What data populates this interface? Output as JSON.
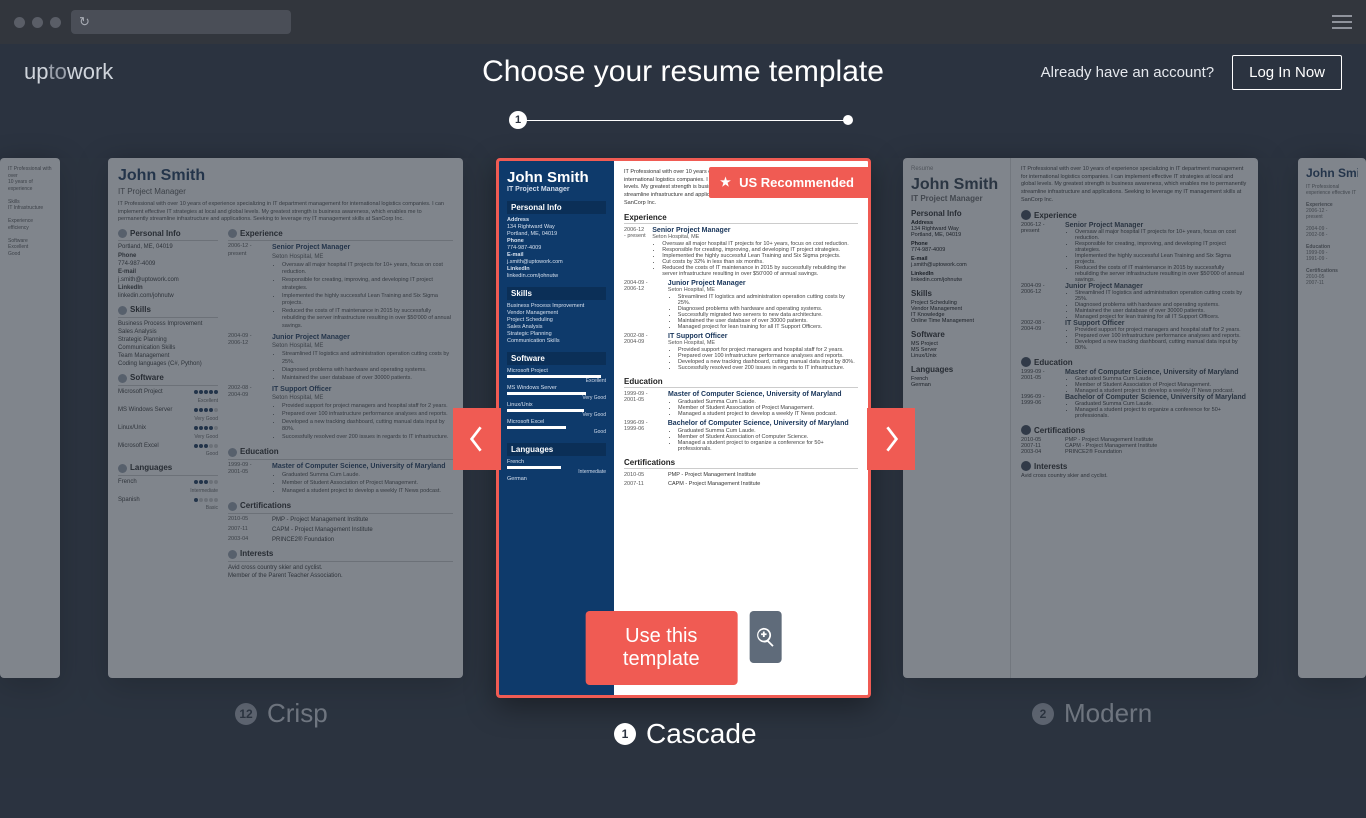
{
  "header": {
    "logo_a": "up",
    "logo_b": "to",
    "logo_c": "work",
    "title": "Choose your resume template",
    "account_q": "Already have an account?",
    "login": "Log In Now"
  },
  "progress": {
    "step": "1"
  },
  "nav": {
    "prev": "‹",
    "next": "›"
  },
  "badge": "US Recommended",
  "cta": {
    "use": "Use this template"
  },
  "labels": {
    "crisp": {
      "n": "12",
      "t": "Crisp"
    },
    "cascade": {
      "n": "1",
      "t": "Cascade"
    },
    "modern": {
      "n": "2",
      "t": "Modern"
    }
  },
  "resume": {
    "name": "John Smith",
    "role": "IT Project Manager",
    "summary": "IT Professional with over 10 years of experience specializing in IT department management for international logistics companies. I can implement effective IT strategies at local and global levels. My greatest strength is business awareness, which enables me to permanently streamline infrastructure and applications. Seeking to leverage my IT management skills at SanCorp Inc.",
    "personal": {
      "h": "Personal Info",
      "addr_h": "Address",
      "addr1": "134 Rightward Way",
      "addr2": "Portland, ME, 04019",
      "phone_h": "Phone",
      "phone": "774-987-4009",
      "email_h": "E-mail",
      "email": "j.smith@uptowork.com",
      "li_h": "LinkedIn",
      "li": "linkedin.com/johnutw"
    },
    "skills": {
      "h": "Skills",
      "items": [
        "Business Process Improvement",
        "Vendor Management",
        "Project Scheduling",
        "Sales Analysis",
        "Strategic Planning",
        "Communication Skills"
      ]
    },
    "skills_ext": [
      "Team Management",
      "Coding languages (C#, Python)"
    ],
    "software": {
      "h": "Software",
      "items": [
        {
          "n": "Microsoft Project",
          "r": "Excellent"
        },
        {
          "n": "MS Windows Server",
          "r": "Very Good"
        },
        {
          "n": "Linux/Unix",
          "r": "Very Good"
        },
        {
          "n": "Microsoft Excel",
          "r": "Good"
        }
      ]
    },
    "languages": {
      "h": "Languages",
      "items": [
        {
          "n": "French",
          "r": "Intermediate"
        },
        {
          "n": "German",
          "r": ""
        },
        {
          "n": "Spanish",
          "r": "Basic"
        }
      ]
    },
    "exp": {
      "h": "Experience",
      "jobs": [
        {
          "d": "2006-12 - present",
          "t": "Senior Project Manager",
          "c": "Seton Hospital, ME",
          "b": [
            "Oversaw all major hospital IT projects for 10+ years, focus on cost reduction.",
            "Responsible for creating, improving, and developing IT project strategies.",
            "Implemented the highly successful Lean Training and Six Sigma projects.",
            "Cut costs by 32% in less than six months.",
            "Reduced the costs of IT maintenance in 2015 by successfully rebuilding the server infrastructure resulting in over $50'000 of annual savings."
          ]
        },
        {
          "d": "2004-09 - 2006-12",
          "t": "Junior Project Manager",
          "c": "Seton Hospital, ME",
          "b": [
            "Streamlined IT logistics and administration operation cutting costs by 25%.",
            "Diagnosed problems with hardware and operating systems.",
            "Successfully migrated two servers to new data architecture.",
            "Maintained the user database of over 30000 patients.",
            "Managed project for lean training for all IT Support Officers."
          ]
        },
        {
          "d": "2002-08 - 2004-09",
          "t": "IT Support Officer",
          "c": "Seton Hospital, ME",
          "b": [
            "Provided support for project managers and hospital staff for 2 years.",
            "Prepared over 100 infrastructure performance analyses and reports.",
            "Developed a new tracking dashboard, cutting manual data input by 80%.",
            "Successfully resolved over 200 issues in regards to IT infrastructure."
          ]
        }
      ]
    },
    "edu": {
      "h": "Education",
      "items": [
        {
          "d": "1999-09 - 2001-05",
          "t": "Master of Computer Science, University of Maryland",
          "b": [
            "Graduated Summa Cum Laude.",
            "Member of Student Association of Project Management.",
            "Managed a student project to develop a weekly IT News podcast."
          ]
        },
        {
          "d": "1996-09 - 1999-06",
          "t": "Bachelor of Computer Science, University of Maryland",
          "b": [
            "Graduated Summa Cum Laude.",
            "Member of Student Association of Computer Science.",
            "Managed a student project to organize a conference for 50+ professionals."
          ]
        }
      ]
    },
    "cert": {
      "h": "Certifications",
      "items": [
        {
          "d": "2010-05",
          "t": "PMP - Project Management Institute"
        },
        {
          "d": "2007-11",
          "t": "CAPM - Project Management Institute"
        },
        {
          "d": "2003-04",
          "t": "PRINCE2® Foundation"
        }
      ]
    },
    "interests": {
      "h": "Interests",
      "items": [
        "Avid cross country skier and cyclist.",
        "Member of the Parent Teacher Association."
      ]
    },
    "modern_extra": {
      "skill_pro": "Project Scheduling",
      "skill_vm": "Vendor Management",
      "skill_it": "IT Knowledge",
      "skill_tm": "Online Time Management",
      "sw1": "MS Project",
      "sw2": "MS Server",
      "sw3": "Linux/Unix"
    }
  }
}
